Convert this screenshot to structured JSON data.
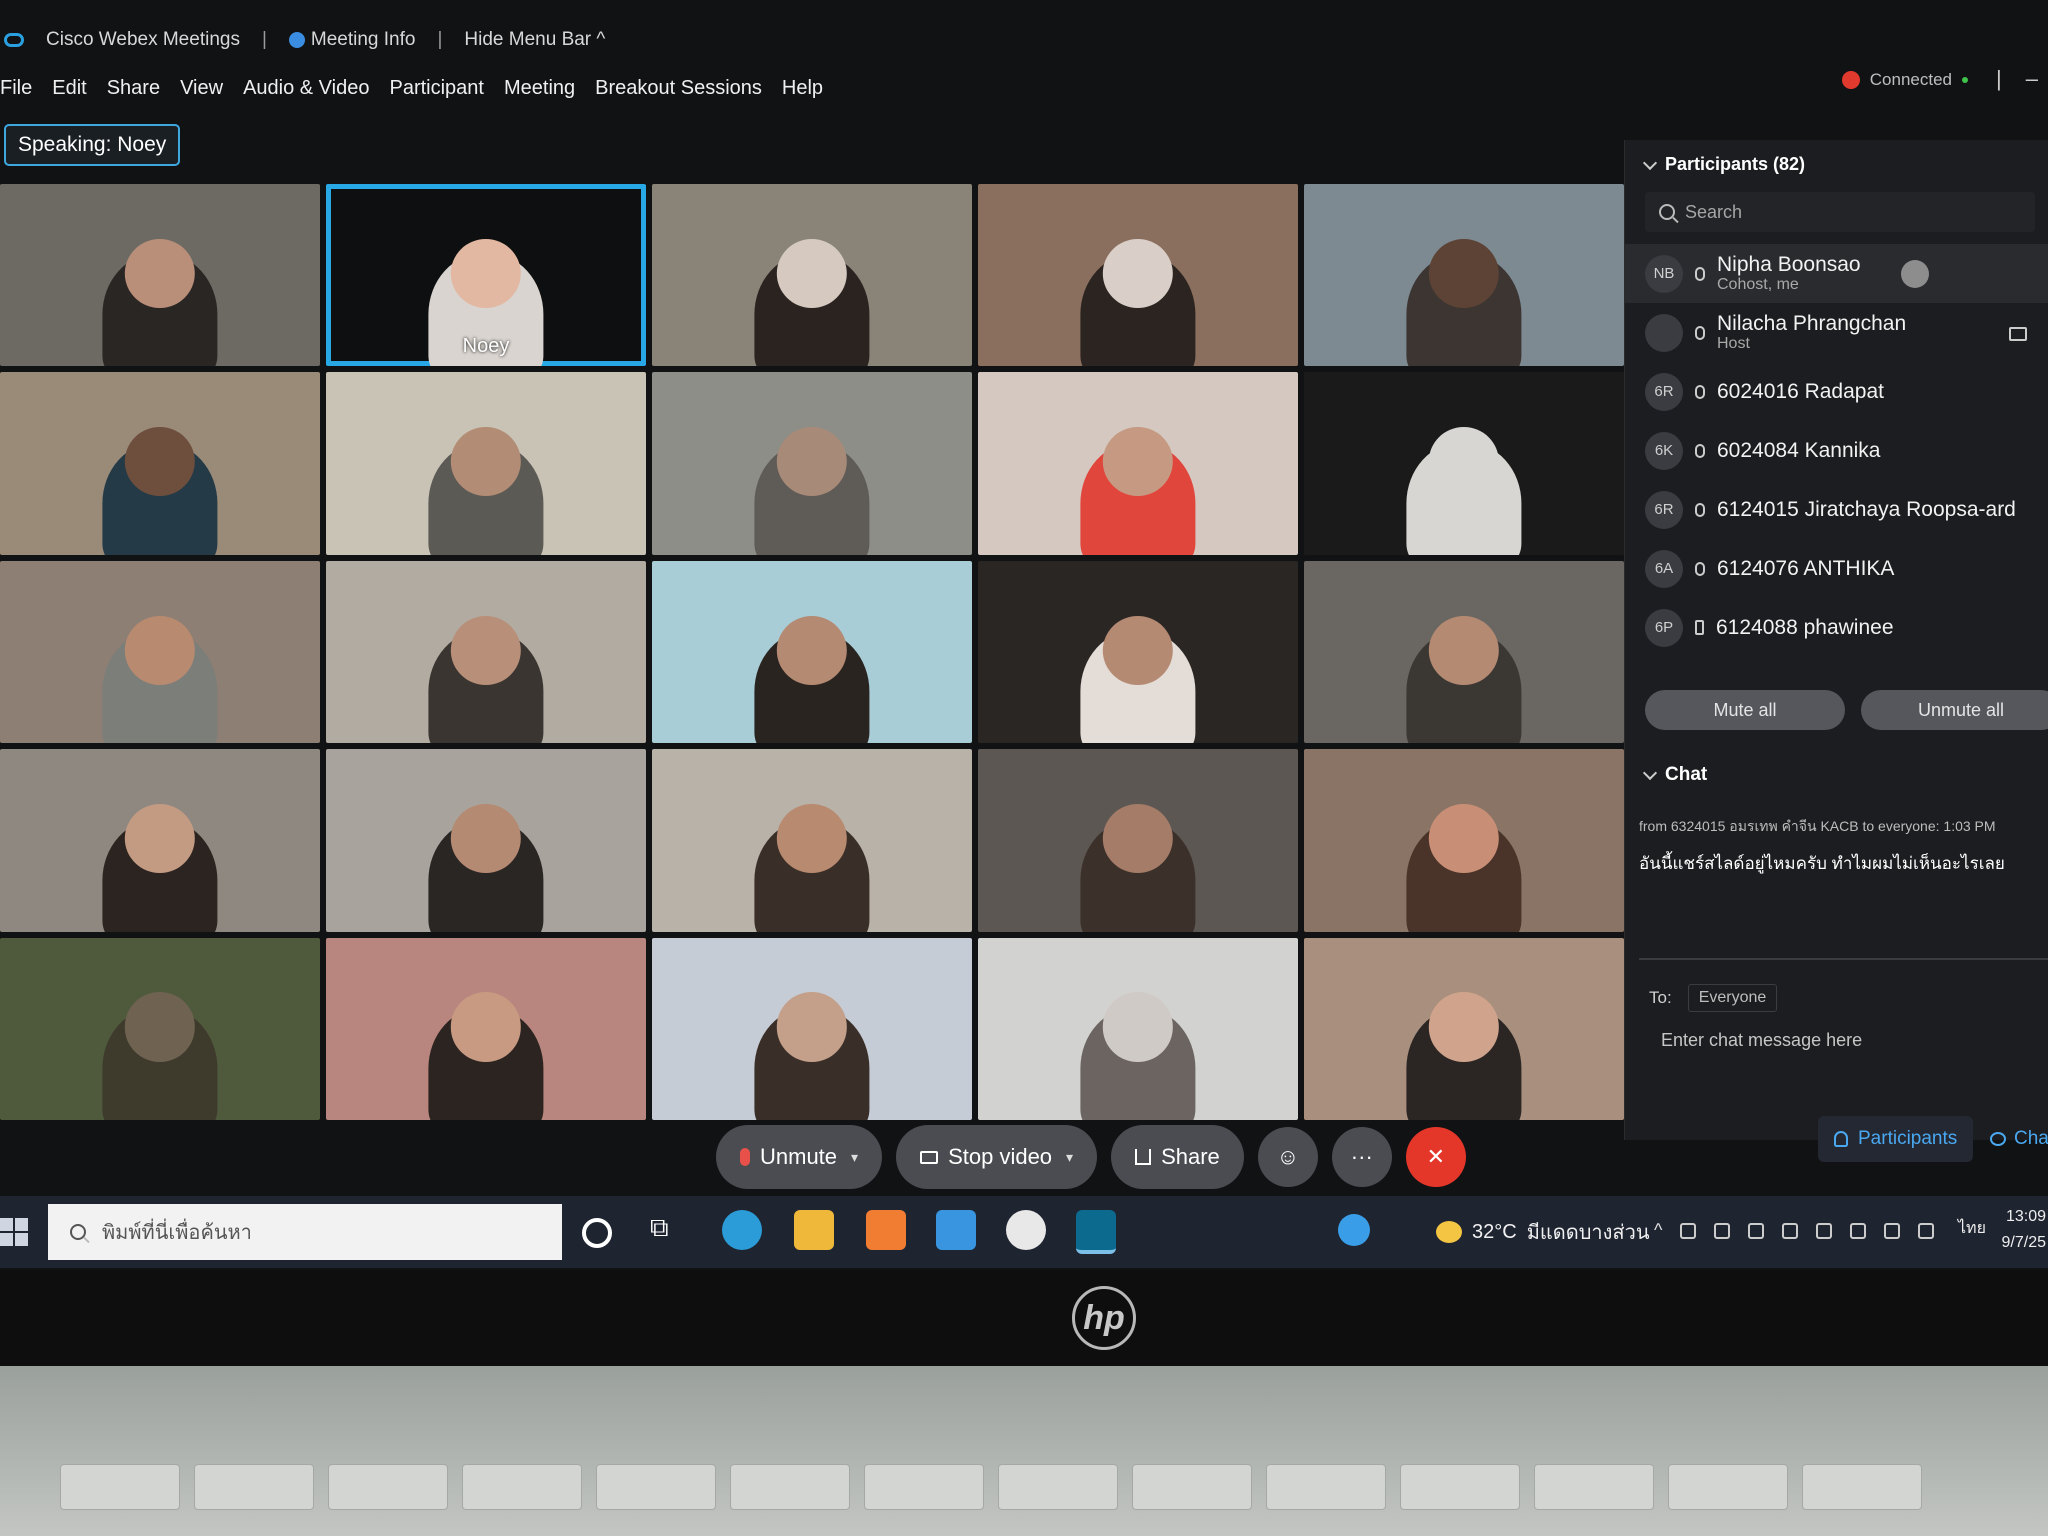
{
  "titlebar": {
    "app_name": "Cisco Webex Meetings",
    "meeting_info": "Meeting Info",
    "hide_menu_bar": "Hide Menu Bar",
    "connected": "Connected"
  },
  "menu": [
    "File",
    "Edit",
    "Share",
    "View",
    "Audio & Video",
    "Participant",
    "Meeting",
    "Breakout Sessions",
    "Help"
  ],
  "speaking": "Speaking: Noey",
  "video_tiles": [
    {
      "label": "",
      "bg": "#6d6a63",
      "head": "#2a2624",
      "face": "#b98f7a",
      "active": false
    },
    {
      "label": "Noey",
      "bg": "#0e0f10",
      "head": "#d9d4cf",
      "face": "#e2b8a3",
      "active": true
    },
    {
      "label": "",
      "bg": "#8a8478",
      "head": "#2a2320",
      "face": "#d5c9c0",
      "active": false
    },
    {
      "label": "",
      "bg": "#8b6f5e",
      "head": "#2b2420",
      "face": "#d9cfc8",
      "active": false
    },
    {
      "label": "",
      "bg": "#7d8a92",
      "head": "#3c3531",
      "face": "#5c4335",
      "active": false
    },
    {
      "label": "",
      "bg": "#9a8a78",
      "head": "#243a47",
      "face": "#6e4e3c",
      "active": false
    },
    {
      "label": "",
      "bg": "#c9c3b6",
      "head": "#5c5a55",
      "face": "#b28c74",
      "active": false
    },
    {
      "label": "",
      "bg": "#8d8e88",
      "head": "#5f5b57",
      "face": "#a88a78",
      "active": false
    },
    {
      "label": "",
      "bg": "#d4c8c0",
      "head": "#e1463c",
      "face": "#c69a82",
      "active": false
    },
    {
      "label": "",
      "bg": "#1a1a1a",
      "head": "#d8d6d2",
      "face": "#d8d6d2",
      "active": false
    },
    {
      "label": "",
      "bg": "#8d7f74",
      "head": "#7c7e7a",
      "face": "#b88a70",
      "active": false
    },
    {
      "label": "",
      "bg": "#b1aba2",
      "head": "#3a3530",
      "face": "#b88f78",
      "active": false
    },
    {
      "label": "",
      "bg": "#a8cdd6",
      "head": "#2a2420",
      "face": "#b58a72",
      "active": false
    },
    {
      "label": "",
      "bg": "#2a2624",
      "head": "#e4dcd6",
      "face": "#b58a72",
      "active": false
    },
    {
      "label": "",
      "bg": "#6a6661",
      "head": "#3b3834",
      "face": "#b58a72",
      "active": false
    },
    {
      "label": "",
      "bg": "#8e8880",
      "head": "#2b2420",
      "face": "#c39a82",
      "active": false
    },
    {
      "label": "",
      "bg": "#a8a49d",
      "head": "#2a2624",
      "face": "#b58a72",
      "active": false
    },
    {
      "label": "",
      "bg": "#b8b2a8",
      "head": "#3a2e28",
      "face": "#b88a70",
      "active": false
    },
    {
      "label": "",
      "bg": "#5c5753",
      "head": "#3b302a",
      "face": "#a47c68",
      "active": false
    },
    {
      "label": "",
      "bg": "#8a7466",
      "head": "#4a3328",
      "face": "#c98f76",
      "active": false
    },
    {
      "label": "",
      "bg": "#4f5a3c",
      "head": "#3e3a2c",
      "face": "#6f6250",
      "active": false
    },
    {
      "label": "",
      "bg": "#b8867e",
      "head": "#2b2420",
      "face": "#c89a82",
      "active": false
    },
    {
      "label": "",
      "bg": "#c5ccd6",
      "head": "#3a2e28",
      "face": "#c4a08a",
      "active": false
    },
    {
      "label": "",
      "bg": "#d2d2d0",
      "head": "#6b6460",
      "face": "#cfcac6",
      "active": false
    },
    {
      "label": "",
      "bg": "#a88f7e",
      "head": "#2b2624",
      "face": "#d0a48c",
      "active": false
    }
  ],
  "participants": {
    "header": "Participants (82)",
    "search_placeholder": "Search",
    "list": [
      {
        "initials": "NB",
        "name": "Nipha Boonsao",
        "role": "Cohost, me",
        "device": "mic"
      },
      {
        "initials": "",
        "name": "Nilacha Phrangchan",
        "role": "Host",
        "device": "mic"
      },
      {
        "initials": "6R",
        "name": "6024016 Radapat",
        "role": "",
        "device": "mic"
      },
      {
        "initials": "6K",
        "name": "6024084 Kannika",
        "role": "",
        "device": "mic"
      },
      {
        "initials": "6R",
        "name": "6124015 Jiratchaya Roopsa-ard",
        "role": "",
        "device": "mic"
      },
      {
        "initials": "6A",
        "name": "6124076 ANTHIKA",
        "role": "",
        "device": "mic"
      },
      {
        "initials": "6P",
        "name": "6124088 phawinee",
        "role": "",
        "device": "phone"
      }
    ],
    "mute_all": "Mute all",
    "unmute_all": "Unmute all"
  },
  "chat": {
    "header": "Chat",
    "message_meta": "from 6324015 อมรเทพ คำจีน KACB to everyone:   1:03 PM",
    "message_text": "อันนี้แชร์สไลด์อยู่ไหมครับ ทำไมผมไม่เห็นอะไรเลย",
    "to_label": "To:",
    "recipient": "Everyone",
    "input_placeholder": "Enter chat message here"
  },
  "controls": {
    "unmute": "Unmute",
    "stop_video": "Stop video",
    "share": "Share",
    "more": "···",
    "end": "✕",
    "participants_tab": "Participants",
    "chat_tab": "Cha"
  },
  "taskbar": {
    "search_placeholder": "พิมพ์ที่นี่เพื่อค้นหา",
    "weather_temp": "32°C",
    "weather_desc": "มีแดดบางส่วน",
    "lang": "ไทย",
    "time": "13:09",
    "date": "9/7/25"
  },
  "laptop": {
    "brand": "hp"
  },
  "colors": {
    "accent": "#29a8e6",
    "end_call": "#e5362a",
    "taskbar": "#1e2430"
  }
}
